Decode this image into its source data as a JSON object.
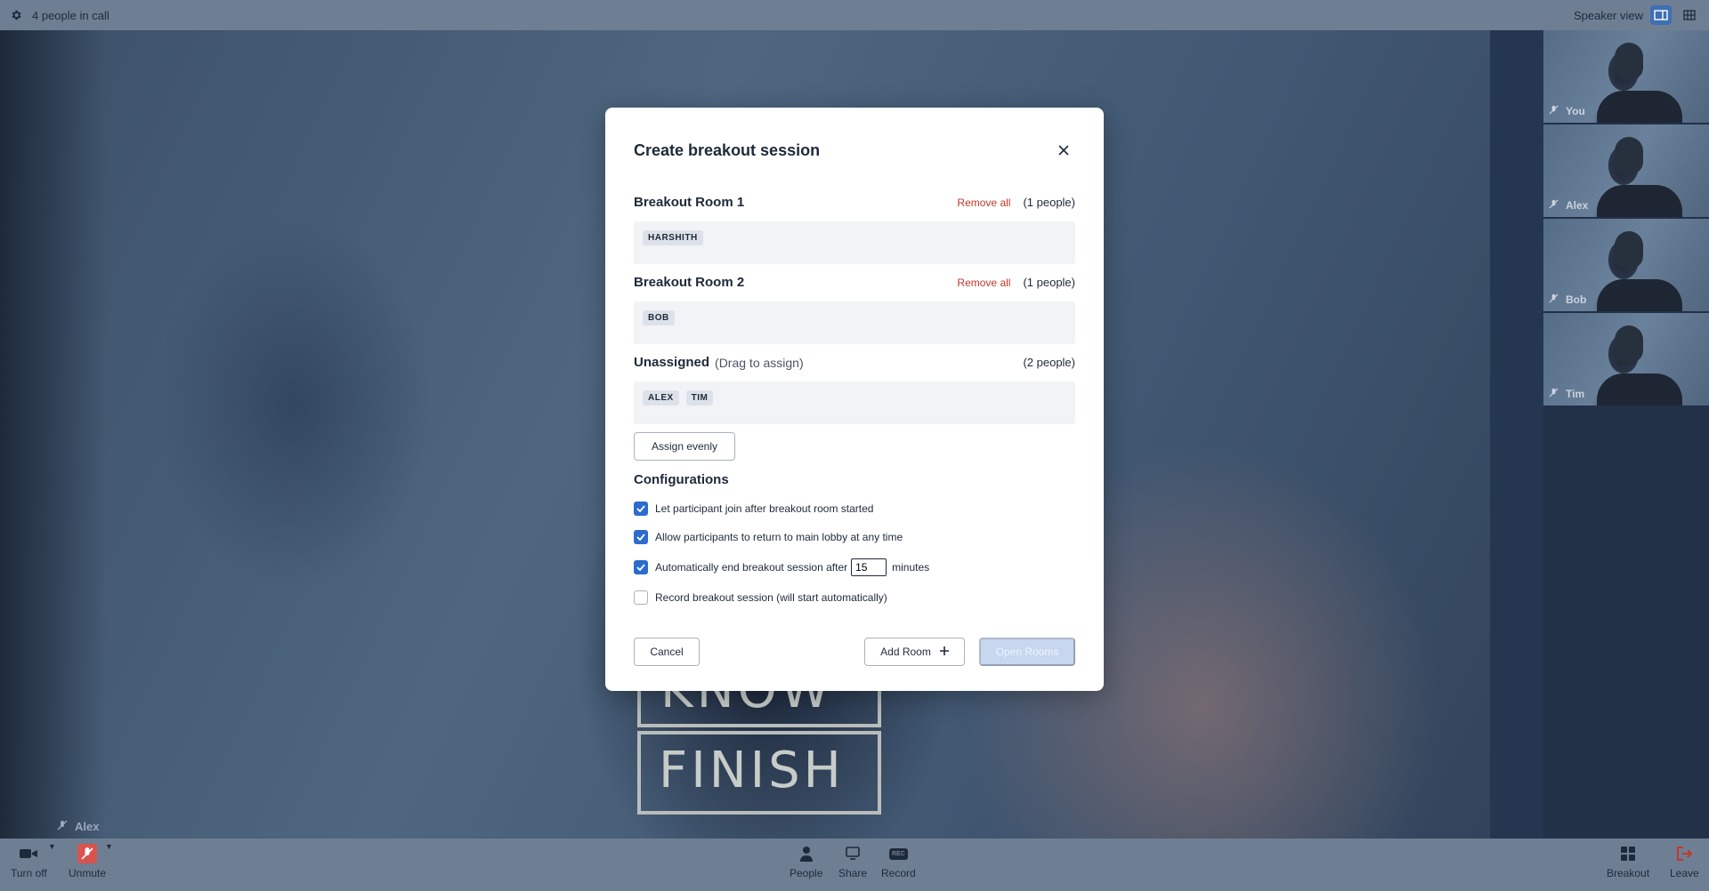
{
  "topbar": {
    "participant_count": "4 people in call",
    "view_label": "Speaker view"
  },
  "main_video": {
    "speaker_name": "Alex",
    "shirt_text_line1": "KNOW",
    "shirt_text_line2": "FINISH"
  },
  "participants": [
    {
      "name": "You"
    },
    {
      "name": "Alex"
    },
    {
      "name": "Bob"
    },
    {
      "name": "Tim"
    }
  ],
  "toolbar": {
    "camera_label": "Turn off",
    "mic_label": "Unmute",
    "people_label": "People",
    "share_label": "Share",
    "record_label": "Record",
    "record_icon_text": "REC",
    "breakout_label": "Breakout",
    "leave_label": "Leave",
    "mic_color": "#d9534f",
    "leave_color": "#c0392b"
  },
  "modal": {
    "title": "Create breakout session",
    "rooms": [
      {
        "name": "Breakout Room 1",
        "remove_label": "Remove all",
        "count": "(1 people)",
        "members": [
          "HARSHITH"
        ]
      },
      {
        "name": "Breakout Room 2",
        "remove_label": "Remove all",
        "count": "(1 people)",
        "members": [
          "BOB"
        ]
      }
    ],
    "unassigned": {
      "name": "Unassigned",
      "hint": "(Drag to assign)",
      "count": "(2 people)",
      "members": [
        "ALEX",
        "TIM"
      ]
    },
    "assign_evenly_label": "Assign evenly",
    "config_title": "Configurations",
    "configs": [
      {
        "label": "Let participant join after breakout room started",
        "checked": true
      },
      {
        "label": "Allow participants to return to main lobby at any time",
        "checked": true
      },
      {
        "label": "Automatically end breakout session after",
        "checked": true,
        "value": "15",
        "suffix": "minutes"
      },
      {
        "label": "Record breakout session (will start automatically)",
        "checked": false
      }
    ],
    "cancel_label": "Cancel",
    "add_room_label": "Add Room",
    "open_rooms_label": "Open Rooms",
    "accent_color": "#2b6cce"
  }
}
